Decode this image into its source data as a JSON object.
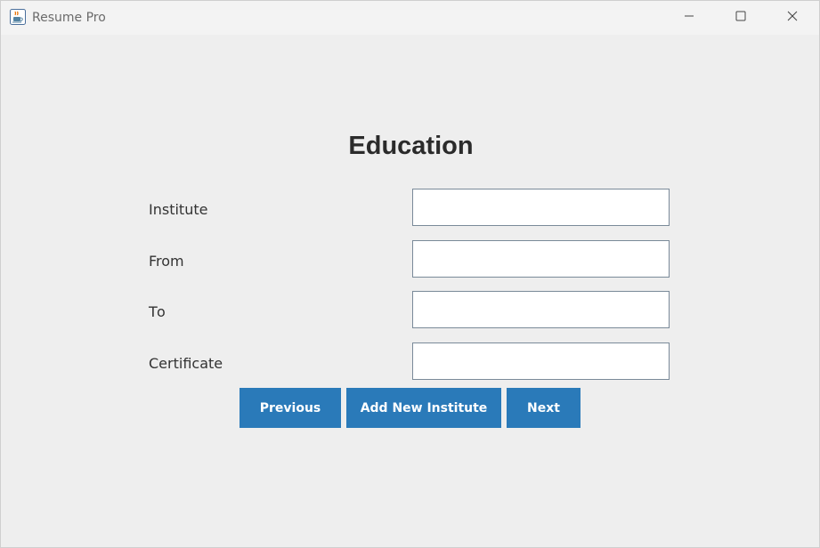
{
  "window": {
    "title": "Resume Pro"
  },
  "page": {
    "heading": "Education"
  },
  "form": {
    "fields": [
      {
        "label": "Institute",
        "value": ""
      },
      {
        "label": "From",
        "value": ""
      },
      {
        "label": "To",
        "value": ""
      },
      {
        "label": "Certificate",
        "value": ""
      }
    ]
  },
  "buttons": {
    "previous": "Previous",
    "add_new": "Add New Institute",
    "next": "Next"
  },
  "colors": {
    "button_bg": "#2a7ab9",
    "window_bg": "#eeeeee"
  },
  "icons": {
    "app": "java-coffee-cup-icon",
    "minimize": "minimize-icon",
    "maximize": "maximize-icon",
    "close": "close-icon"
  }
}
